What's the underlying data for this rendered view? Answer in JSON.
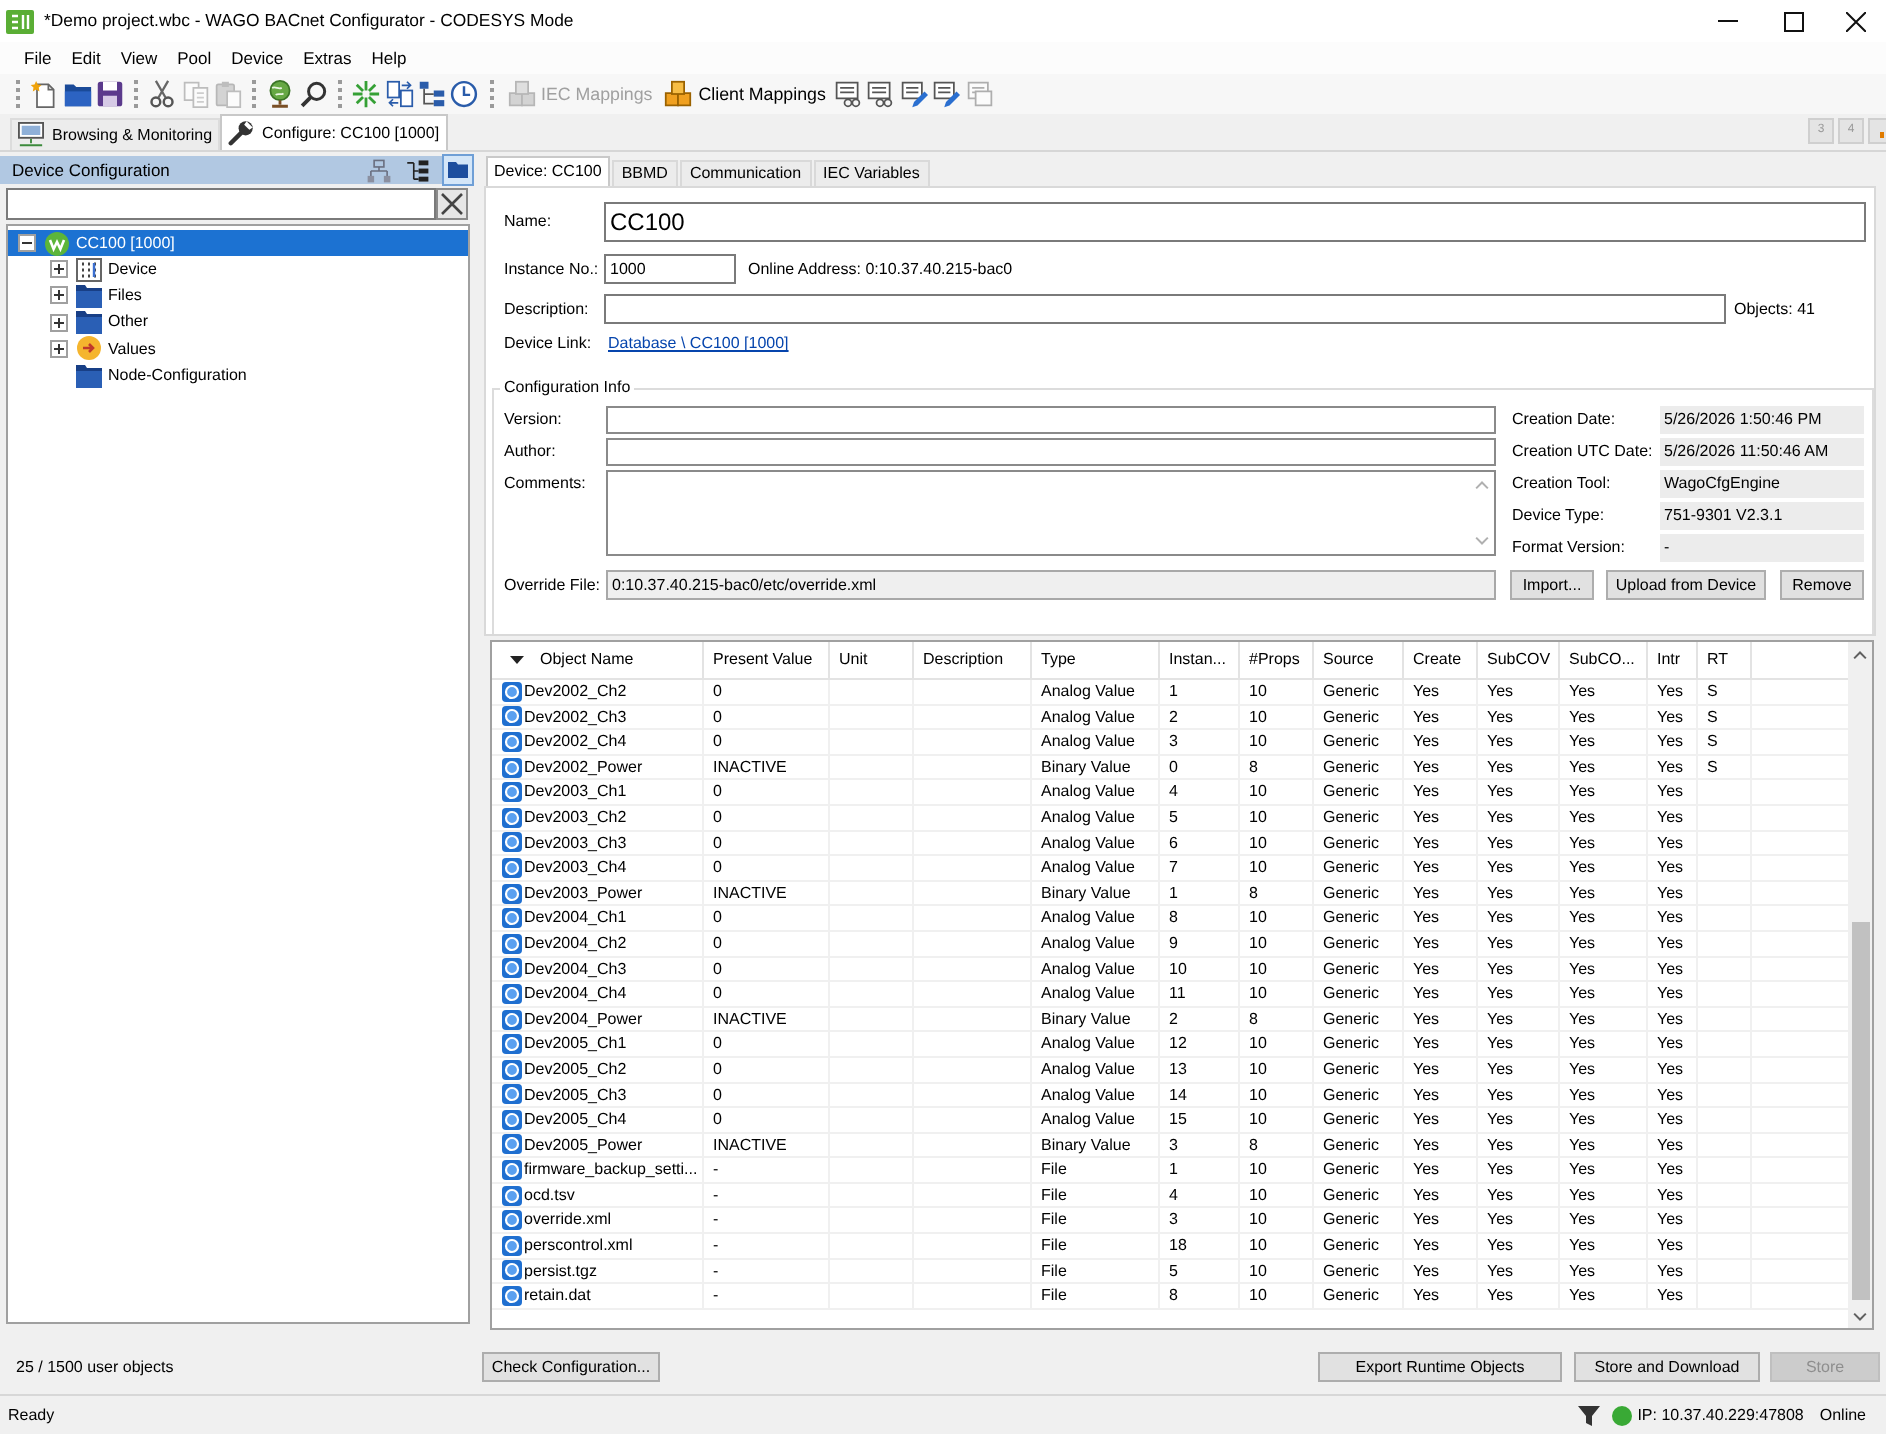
{
  "window": {
    "title": "*Demo project.wbc - WAGO BACnet Configurator - CODESYS Mode"
  },
  "menu": [
    "File",
    "Edit",
    "View",
    "Pool",
    "Device",
    "Extras",
    "Help"
  ],
  "toolbar": {
    "groups": [
      [
        {
          "kind": "icon",
          "disabled": false
        },
        {
          "kind": "icon",
          "disabled": false
        },
        {
          "kind": "icon",
          "disabled": false
        }
      ],
      [
        {
          "kind": "icon",
          "disabled": false
        },
        {
          "kind": "icon",
          "disabled": true
        },
        {
          "kind": "icon",
          "disabled": true
        }
      ],
      [
        {
          "kind": "icon",
          "disabled": false
        },
        {
          "kind": "icon",
          "disabled": false
        }
      ],
      [
        {
          "kind": "icon",
          "disabled": false
        },
        {
          "kind": "icon",
          "disabled": false
        },
        {
          "kind": "icon",
          "disabled": false
        },
        {
          "kind": "icon",
          "disabled": false
        }
      ],
      [
        {
          "kind": "button",
          "label": "IEC Mappings",
          "disabled": true
        },
        {
          "kind": "button",
          "label": "Client Mappings",
          "disabled": false
        },
        {
          "kind": "icon",
          "disabled": false
        },
        {
          "kind": "icon",
          "disabled": false
        },
        {
          "kind": "icon",
          "disabled": false
        },
        {
          "kind": "icon",
          "disabled": false
        },
        {
          "kind": "icon",
          "disabled": true
        }
      ]
    ]
  },
  "document_tabs": {
    "tabs": [
      {
        "label": "Browsing & Monitoring",
        "selected": false
      },
      {
        "label": "Configure: CC100 [1000]",
        "selected": true
      }
    ],
    "scroll_buttons": [
      "3",
      "4"
    ]
  },
  "device_panel": {
    "title": "Device Configuration",
    "view_buttons": [
      {
        "selected": false
      },
      {
        "selected": false
      },
      {
        "selected": true
      }
    ],
    "tree": [
      {
        "label": "CC100 [1000]",
        "kind": "controller",
        "selected": true,
        "expanded": true,
        "children": [
          {
            "label": "Device",
            "kind": "device",
            "selected": false,
            "expanded": false
          },
          {
            "label": "Files",
            "kind": "folder",
            "selected": false,
            "expanded": false
          },
          {
            "label": "Other",
            "kind": "folder",
            "selected": false,
            "expanded": false
          },
          {
            "label": "Values",
            "kind": "values",
            "selected": false,
            "expanded": false
          },
          {
            "label": "Node-Configuration",
            "kind": "folder",
            "selected": false
          }
        ]
      }
    ],
    "summary": "25 / 1500 user objects"
  },
  "device_tabs": [
    {
      "label": "Device: CC100",
      "selected": true
    },
    {
      "label": "BBMD",
      "selected": false
    },
    {
      "label": "Communication",
      "selected": false
    },
    {
      "label": "IEC Variables",
      "selected": false
    }
  ],
  "device_form": {
    "name": {
      "label": "Name:",
      "value": "CC100"
    },
    "instance": {
      "label": "Instance No.:",
      "value": "1000"
    },
    "online_address": "Online Address: 0:10.37.40.215-bac0",
    "description": {
      "label": "Description:"
    },
    "objects_count": "Objects: 41",
    "device_link": {
      "label": "Device Link:",
      "link": "Database \\ CC100 [1000]"
    }
  },
  "configuration_info": {
    "title": "Configuration Info",
    "fields": [
      {
        "label": "Version:",
        "kind": "line"
      },
      {
        "label": "Author:",
        "kind": "line"
      },
      {
        "label": "Comments:",
        "kind": "multiline"
      }
    ],
    "properties": [
      {
        "label": "Creation Date:",
        "value": "5/26/2026 1:50:46 PM"
      },
      {
        "label": "Creation UTC Date:",
        "value": "5/26/2026 11:50:46 AM"
      },
      {
        "label": "Creation Tool:",
        "value": "WagoCfgEngine"
      },
      {
        "label": "Device Type:",
        "value": "751-9301 V2.3.1"
      },
      {
        "label": "Format Version:",
        "value": "-"
      }
    ],
    "override_file": {
      "label": "Override File:",
      "value": "0:10.37.40.215-bac0/etc/override.xml"
    },
    "buttons": [
      "Import...",
      "Upload from Device",
      "Remove"
    ]
  },
  "objects_table": {
    "columns": [
      {
        "label": "Object Name",
        "sorted": true
      },
      {
        "label": "Present Value",
        "sorted": false
      },
      {
        "label": "Unit",
        "sorted": false
      },
      {
        "label": "Description",
        "sorted": false
      },
      {
        "label": "Type",
        "sorted": false
      },
      {
        "label": "Instan...",
        "sorted": false
      },
      {
        "label": "#Props",
        "sorted": false
      },
      {
        "label": "Source",
        "sorted": false
      },
      {
        "label": "Create",
        "sorted": false
      },
      {
        "label": "SubCOV",
        "sorted": false
      },
      {
        "label": "SubCO...",
        "sorted": false
      },
      {
        "label": "Intr",
        "sorted": false
      },
      {
        "label": "RT",
        "sorted": false
      }
    ],
    "rows": [
      {
        "object_name": "Dev2002_Ch2",
        "present_value": "0",
        "type": "Analog Value",
        "column_6": "1",
        "props": "10",
        "source": "Generic",
        "create": "Yes",
        "subcov": "Yes",
        "column_11": "Yes",
        "intr": "Yes",
        "rt": "S"
      },
      {
        "object_name": "Dev2002_Ch3",
        "present_value": "0",
        "type": "Analog Value",
        "column_6": "2",
        "props": "10",
        "source": "Generic",
        "create": "Yes",
        "subcov": "Yes",
        "column_11": "Yes",
        "intr": "Yes",
        "rt": "S"
      },
      {
        "object_name": "Dev2002_Ch4",
        "present_value": "0",
        "type": "Analog Value",
        "column_6": "3",
        "props": "10",
        "source": "Generic",
        "create": "Yes",
        "subcov": "Yes",
        "column_11": "Yes",
        "intr": "Yes",
        "rt": "S"
      },
      {
        "object_name": "Dev2002_Power",
        "present_value": "INACTIVE",
        "type": "Binary Value",
        "column_6": "0",
        "props": "8",
        "source": "Generic",
        "create": "Yes",
        "subcov": "Yes",
        "column_11": "Yes",
        "intr": "Yes",
        "rt": "S"
      },
      {
        "object_name": "Dev2003_Ch1",
        "present_value": "0",
        "type": "Analog Value",
        "column_6": "4",
        "props": "10",
        "source": "Generic",
        "create": "Yes",
        "subcov": "Yes",
        "column_11": "Yes",
        "intr": "Yes"
      },
      {
        "object_name": "Dev2003_Ch2",
        "present_value": "0",
        "type": "Analog Value",
        "column_6": "5",
        "props": "10",
        "source": "Generic",
        "create": "Yes",
        "subcov": "Yes",
        "column_11": "Yes",
        "intr": "Yes"
      },
      {
        "object_name": "Dev2003_Ch3",
        "present_value": "0",
        "type": "Analog Value",
        "column_6": "6",
        "props": "10",
        "source": "Generic",
        "create": "Yes",
        "subcov": "Yes",
        "column_11": "Yes",
        "intr": "Yes"
      },
      {
        "object_name": "Dev2003_Ch4",
        "present_value": "0",
        "type": "Analog Value",
        "column_6": "7",
        "props": "10",
        "source": "Generic",
        "create": "Yes",
        "subcov": "Yes",
        "column_11": "Yes",
        "intr": "Yes"
      },
      {
        "object_name": "Dev2003_Power",
        "present_value": "INACTIVE",
        "type": "Binary Value",
        "column_6": "1",
        "props": "8",
        "source": "Generic",
        "create": "Yes",
        "subcov": "Yes",
        "column_11": "Yes",
        "intr": "Yes"
      },
      {
        "object_name": "Dev2004_Ch1",
        "present_value": "0",
        "type": "Analog Value",
        "column_6": "8",
        "props": "10",
        "source": "Generic",
        "create": "Yes",
        "subcov": "Yes",
        "column_11": "Yes",
        "intr": "Yes"
      },
      {
        "object_name": "Dev2004_Ch2",
        "present_value": "0",
        "type": "Analog Value",
        "column_6": "9",
        "props": "10",
        "source": "Generic",
        "create": "Yes",
        "subcov": "Yes",
        "column_11": "Yes",
        "intr": "Yes"
      },
      {
        "object_name": "Dev2004_Ch3",
        "present_value": "0",
        "type": "Analog Value",
        "column_6": "10",
        "props": "10",
        "source": "Generic",
        "create": "Yes",
        "subcov": "Yes",
        "column_11": "Yes",
        "intr": "Yes"
      },
      {
        "object_name": "Dev2004_Ch4",
        "present_value": "0",
        "type": "Analog Value",
        "column_6": "11",
        "props": "10",
        "source": "Generic",
        "create": "Yes",
        "subcov": "Yes",
        "column_11": "Yes",
        "intr": "Yes"
      },
      {
        "object_name": "Dev2004_Power",
        "present_value": "INACTIVE",
        "type": "Binary Value",
        "column_6": "2",
        "props": "8",
        "source": "Generic",
        "create": "Yes",
        "subcov": "Yes",
        "column_11": "Yes",
        "intr": "Yes"
      },
      {
        "object_name": "Dev2005_Ch1",
        "present_value": "0",
        "type": "Analog Value",
        "column_6": "12",
        "props": "10",
        "source": "Generic",
        "create": "Yes",
        "subcov": "Yes",
        "column_11": "Yes",
        "intr": "Yes"
      },
      {
        "object_name": "Dev2005_Ch2",
        "present_value": "0",
        "type": "Analog Value",
        "column_6": "13",
        "props": "10",
        "source": "Generic",
        "create": "Yes",
        "subcov": "Yes",
        "column_11": "Yes",
        "intr": "Yes"
      },
      {
        "object_name": "Dev2005_Ch3",
        "present_value": "0",
        "type": "Analog Value",
        "column_6": "14",
        "props": "10",
        "source": "Generic",
        "create": "Yes",
        "subcov": "Yes",
        "column_11": "Yes",
        "intr": "Yes"
      },
      {
        "object_name": "Dev2005_Ch4",
        "present_value": "0",
        "type": "Analog Value",
        "column_6": "15",
        "props": "10",
        "source": "Generic",
        "create": "Yes",
        "subcov": "Yes",
        "column_11": "Yes",
        "intr": "Yes"
      },
      {
        "object_name": "Dev2005_Power",
        "present_value": "INACTIVE",
        "type": "Binary Value",
        "column_6": "3",
        "props": "8",
        "source": "Generic",
        "create": "Yes",
        "subcov": "Yes",
        "column_11": "Yes",
        "intr": "Yes"
      },
      {
        "object_name": "firmware_backup_setti...",
        "present_value": "-",
        "type": "File",
        "column_6": "1",
        "props": "10",
        "source": "Generic",
        "create": "Yes",
        "subcov": "Yes",
        "column_11": "Yes",
        "intr": "Yes"
      },
      {
        "object_name": "ocd.tsv",
        "present_value": "-",
        "type": "File",
        "column_6": "4",
        "props": "10",
        "source": "Generic",
        "create": "Yes",
        "subcov": "Yes",
        "column_11": "Yes",
        "intr": "Yes"
      },
      {
        "object_name": "override.xml",
        "present_value": "-",
        "type": "File",
        "column_6": "3",
        "props": "10",
        "source": "Generic",
        "create": "Yes",
        "subcov": "Yes",
        "column_11": "Yes",
        "intr": "Yes"
      },
      {
        "object_name": "perscontrol.xml",
        "present_value": "-",
        "type": "File",
        "column_6": "18",
        "props": "10",
        "source": "Generic",
        "create": "Yes",
        "subcov": "Yes",
        "column_11": "Yes",
        "intr": "Yes"
      },
      {
        "object_name": "persist.tgz",
        "present_value": "-",
        "type": "File",
        "column_6": "5",
        "props": "10",
        "source": "Generic",
        "create": "Yes",
        "subcov": "Yes",
        "column_11": "Yes",
        "intr": "Yes"
      },
      {
        "object_name": "retain.dat",
        "present_value": "-",
        "type": "File",
        "column_6": "8",
        "props": "10",
        "source": "Generic",
        "create": "Yes",
        "subcov": "Yes",
        "column_11": "Yes",
        "intr": "Yes"
      }
    ]
  },
  "bottom_buttons": {
    "left": [
      {
        "label": "Check Configuration...",
        "disabled": false
      }
    ],
    "right": [
      {
        "label": "Export Runtime Objects",
        "disabled": false
      },
      {
        "label": "Store and Download",
        "disabled": false
      },
      {
        "label": "Store",
        "disabled": true
      }
    ]
  },
  "status_bar": {
    "text": "Ready",
    "connection": {
      "online": true,
      "address": "IP: 10.37.40.229:47808",
      "state": "Online"
    }
  }
}
